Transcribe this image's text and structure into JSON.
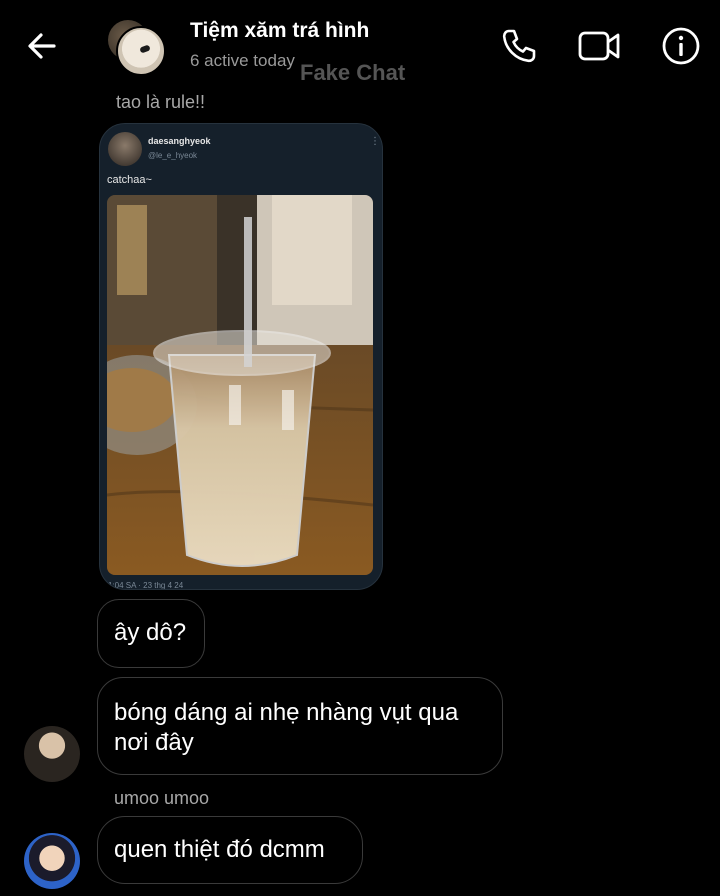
{
  "header": {
    "title": "Tiệm xăm trá hình",
    "subtitle": "6 active today",
    "watermark": "Fake Chat",
    "icons": [
      "back-arrow-icon",
      "phone-icon",
      "video-camera-icon",
      "info-icon"
    ]
  },
  "messages": {
    "label_top": "tao là rule!!",
    "tweet": {
      "name": "daesanghyeok",
      "handle": "@le_e_hyeok",
      "text": "catchaa~",
      "meta": "1:04 SA · 23 thg 4 24"
    },
    "bubble_1": "ây dô?",
    "bubble_2": "bóng dáng ai nhẹ nhàng vụt qua nơi đây",
    "label_mid": "umoo umoo",
    "bubble_3": "quen thiệt đó dcmm"
  },
  "colors": {
    "background": "#000000",
    "bubble_border": "#3a3a3a",
    "muted_text": "#a8a8a8",
    "tweet_bg": "#15202b"
  }
}
